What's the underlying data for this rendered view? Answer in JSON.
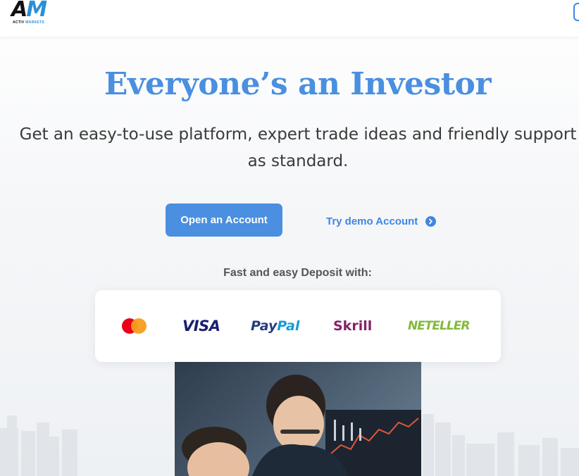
{
  "header": {
    "logo_mark_a": "A",
    "logo_mark_m": "M",
    "logo_sub_1": "ACTIV",
    "logo_sub_2": "MARKETS"
  },
  "hero": {
    "title": "Everyone’s an Investor",
    "subtitle": "Get an easy-to-use platform, expert trade ideas and friendly support as standard.",
    "open_account_label": "Open an Account",
    "demo_label": "Try demo Account"
  },
  "deposit": {
    "label": "Fast and easy Deposit with:",
    "methods": {
      "mastercard": "mastercard",
      "visa": "VISA",
      "paypal_1": "Pay",
      "paypal_2": "Pal",
      "skrill": "Skrill",
      "neteller": "NETELLER"
    }
  },
  "colors": {
    "accent": "#4a8fe0",
    "text": "#3a3a3a"
  }
}
